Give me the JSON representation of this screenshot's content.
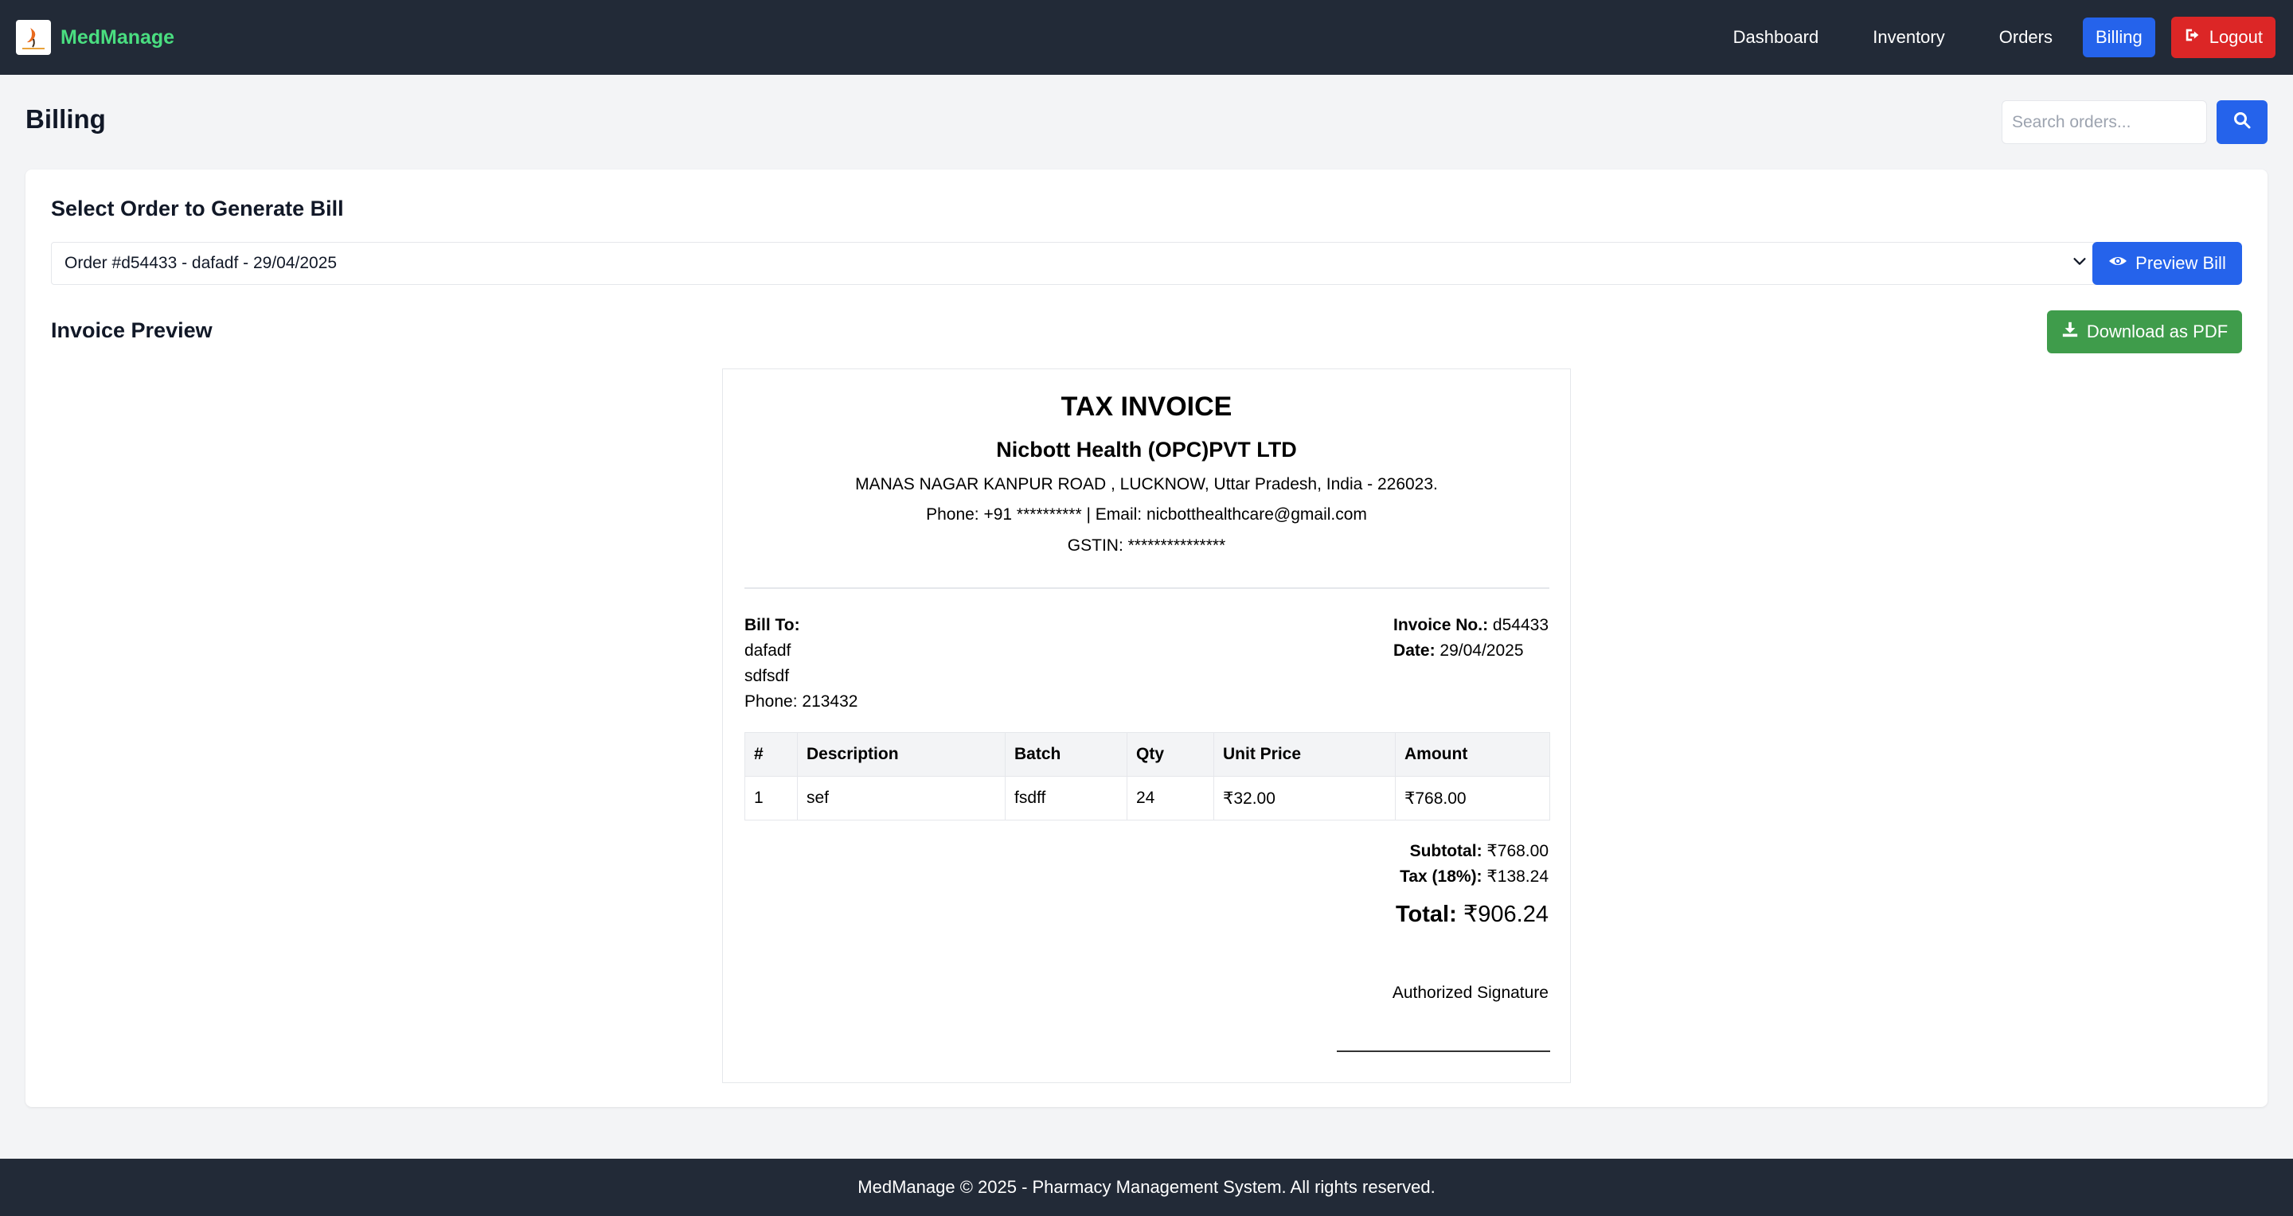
{
  "app": {
    "name": "MedManage"
  },
  "nav": {
    "dashboard": "Dashboard",
    "inventory": "Inventory",
    "orders": "Orders",
    "billing": "Billing",
    "logout": "Logout"
  },
  "page": {
    "title": "Billing",
    "search_placeholder": "Search orders..."
  },
  "billing": {
    "select_title": "Select Order to Generate Bill",
    "selected_order": "Order #d54433 - dafadf - 29/04/2025",
    "preview_button": "Preview Bill",
    "invoice_preview_title": "Invoice Preview",
    "download_button": "Download as PDF"
  },
  "invoice": {
    "title": "TAX INVOICE",
    "company": "Nicbott Health (OPC)PVT LTD",
    "address": "MANAS NAGAR KANPUR ROAD , LUCKNOW, Uttar Pradesh, India - 226023.",
    "contact": "Phone: +91 ********** | Email: nicbotthealthcare@gmail.com",
    "gstin": "GSTIN: ***************",
    "bill_to_label": "Bill To:",
    "customer_name": "dafadf",
    "customer_address": "sdfsdf",
    "customer_phone": "Phone: 213432",
    "invoice_no_label": "Invoice No.:",
    "invoice_no": "d54433",
    "date_label": "Date:",
    "date": "29/04/2025",
    "columns": [
      "#",
      "Description",
      "Batch",
      "Qty",
      "Unit Price",
      "Amount"
    ],
    "rows": [
      [
        "1",
        "sef",
        "fsdff",
        "24",
        "₹32.00",
        "₹768.00"
      ]
    ],
    "subtotal_label": "Subtotal:",
    "subtotal": "₹768.00",
    "tax_label": "Tax (18%):",
    "tax": "₹138.24",
    "total_label": "Total:",
    "total": "₹906.24",
    "signature": "Authorized Signature"
  },
  "footer": {
    "text": "MedManage © 2025 - Pharmacy Management System. All rights reserved."
  },
  "colors": {
    "navbar": "#222a37",
    "brand": "#4ade80",
    "primary": "#2563eb",
    "danger": "#dc2626",
    "success": "#3f9c4b"
  },
  "icons": {
    "brand_logo": "pharmacy-logo-icon",
    "logout": "sign-out-icon",
    "search": "search-icon",
    "select_chevron": "chevron-down-icon",
    "preview": "eye-icon",
    "download": "download-icon"
  }
}
